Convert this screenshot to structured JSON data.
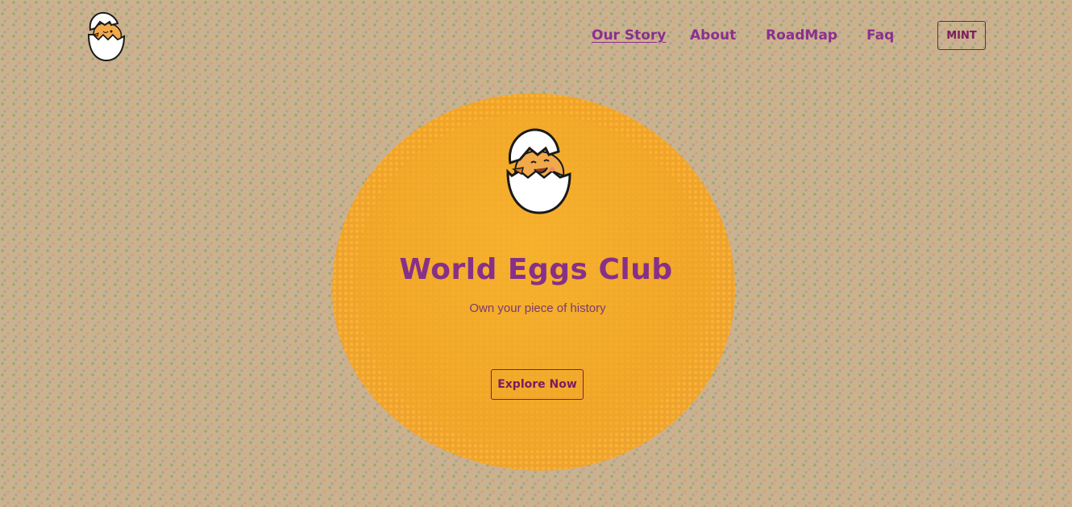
{
  "brand": {
    "logo_icon": "chick-in-egg-icon"
  },
  "nav": {
    "links": [
      {
        "label": "Our Story",
        "active": true
      },
      {
        "label": "About",
        "active": false
      },
      {
        "label": "RoadMap",
        "active": false
      },
      {
        "label": "Faq",
        "active": false
      }
    ],
    "mint_label": "MINT"
  },
  "hero": {
    "title": "World Eggs Club",
    "subtitle": "Own your piece of history",
    "cta_label": "Explore Now",
    "logo_icon": "chick-in-egg-icon"
  },
  "watermark": {
    "title": "Activate Windows",
    "subtitle": "Go to Settings to activate Windows."
  },
  "colors": {
    "accent": "#86308a",
    "button_border": "#7d1b5e",
    "background": "#c9b291",
    "hero_blob": "#eea32e"
  }
}
